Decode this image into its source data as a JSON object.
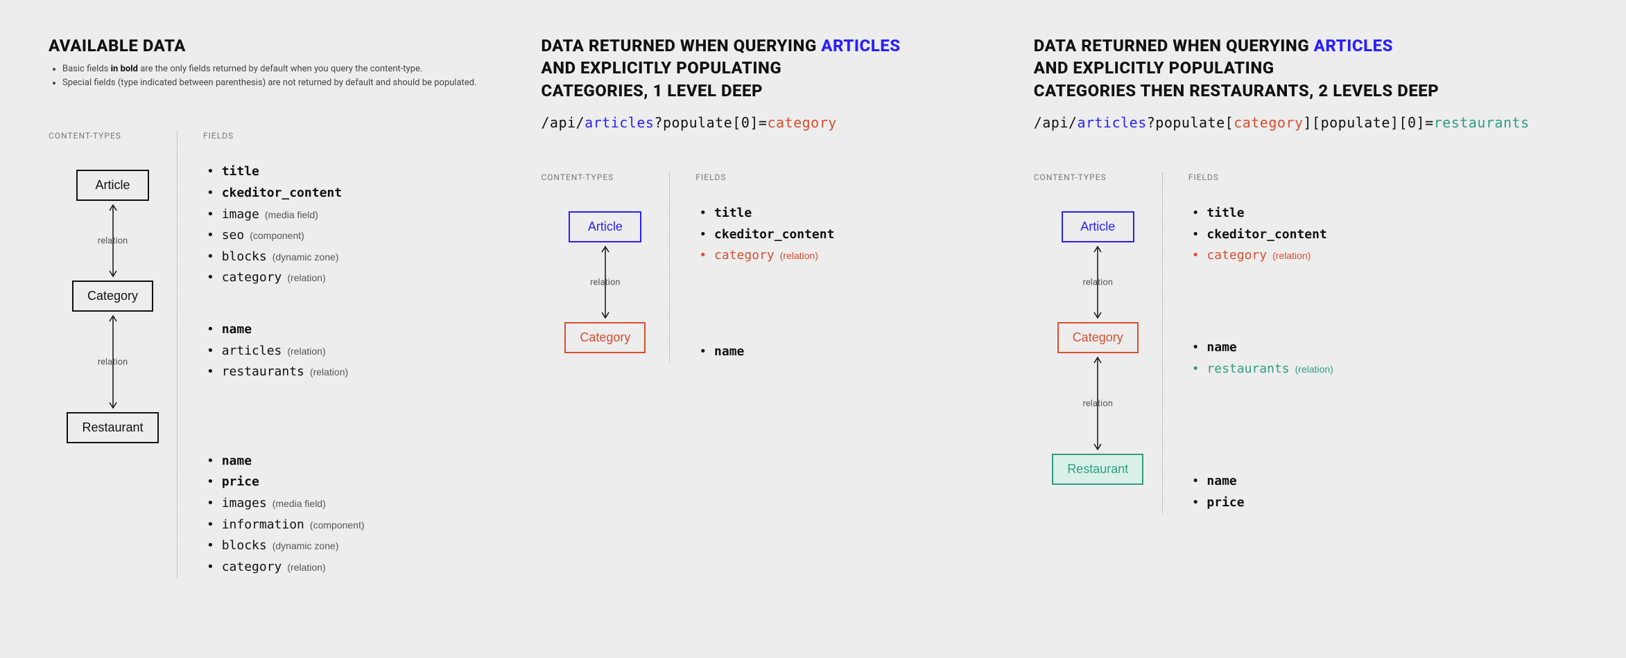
{
  "colHeaders": {
    "types": "CONTENT-TYPES",
    "fields": "FIELDS"
  },
  "relationLabel": "relation",
  "panelA": {
    "title": "AVAILABLE DATA",
    "sub1_a": "Basic fields ",
    "sub1_b": "in bold",
    "sub1_c": " are the only fields returned by default when you query the content-type.",
    "sub2": "Special fields (type indicated between parenthesis) are not returned by default and should be populated.",
    "entities": {
      "article": "Article",
      "category": "Category",
      "restaurant": "Restaurant"
    },
    "article": [
      {
        "name": "title",
        "bold": true
      },
      {
        "name": "ckeditor_content",
        "bold": true
      },
      {
        "name": "image",
        "meta": "(media field)"
      },
      {
        "name": "seo",
        "meta": "(component)"
      },
      {
        "name": "blocks",
        "meta": "(dynamic zone)"
      },
      {
        "name": "category",
        "meta": "(relation)"
      }
    ],
    "category": [
      {
        "name": "name",
        "bold": true
      },
      {
        "name": "articles",
        "meta": "(relation)"
      },
      {
        "name": "restaurants",
        "meta": "(relation)"
      }
    ],
    "restaurant": [
      {
        "name": "name",
        "bold": true
      },
      {
        "name": "price",
        "bold": true
      },
      {
        "name": "images",
        "meta": "(media field)"
      },
      {
        "name": "information",
        "meta": "(component)"
      },
      {
        "name": "blocks",
        "meta": "(dynamic zone)"
      },
      {
        "name": "category",
        "meta": "(relation)"
      }
    ]
  },
  "panelB": {
    "t1": "DATA RETURNED WHEN QUERYING ",
    "t_art": "ARTICLES",
    "t2": "AND EXPLICITLY POPULATING",
    "t3": "CATEGORIES, 1 LEVEL DEEP",
    "q1": "/api/",
    "q2": "articles",
    "q3": "?populate[0]=",
    "q4": "category",
    "entities": {
      "article": "Article",
      "category": "Category"
    },
    "article": [
      {
        "name": "title",
        "bold": true
      },
      {
        "name": "ckeditor_content",
        "bold": true
      },
      {
        "name": "category",
        "meta": "(relation)",
        "red": true
      }
    ],
    "category": [
      {
        "name": "name",
        "bold": true
      }
    ]
  },
  "panelC": {
    "t1": "DATA RETURNED WHEN QUERYING ",
    "t_art": "ARTICLES",
    "t2": "AND EXPLICITLY POPULATING",
    "t3": "CATEGORIES THEN RESTAURANTS, 2 LEVELS DEEP",
    "q1": "/api/",
    "q2": "articles",
    "q3": "?populate[",
    "q4": "category",
    "q5": "][populate][0]=",
    "q6": "restaurants",
    "entities": {
      "article": "Article",
      "category": "Category",
      "restaurant": "Restaurant"
    },
    "article": [
      {
        "name": "title",
        "bold": true
      },
      {
        "name": "ckeditor_content",
        "bold": true
      },
      {
        "name": "category",
        "meta": "(relation)",
        "red": true
      }
    ],
    "category": [
      {
        "name": "name",
        "bold": true
      },
      {
        "name": "restaurants",
        "meta": "(relation)",
        "green": true
      }
    ],
    "restaurant": [
      {
        "name": "name",
        "bold": true
      },
      {
        "name": "price",
        "bold": true
      }
    ]
  }
}
